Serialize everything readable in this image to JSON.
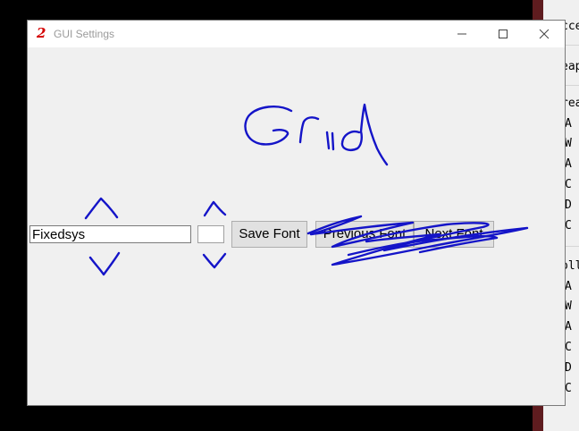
{
  "window": {
    "title": "GUI Settings",
    "app_icon_glyph": "2",
    "controls": [
      "minimize-icon",
      "maximize-icon",
      "close-icon"
    ]
  },
  "form": {
    "font_name_value": "Fixedsys",
    "font_size_value": "",
    "save_button_label": "Save Font",
    "previous_button_label": "Previous Font",
    "next_button_label": "Next Font"
  },
  "background_window": {
    "header_fragments": [
      "cce",
      "eap",
      "rea",
      "oll"
    ],
    "item_fragments": [
      "A",
      "W",
      "A",
      "C",
      "D",
      "C",
      "A",
      "W",
      "A",
      "C",
      "D",
      "C"
    ]
  },
  "annotations": {
    "handwritten_text": "Grid",
    "ink_color": "#1414c8"
  }
}
